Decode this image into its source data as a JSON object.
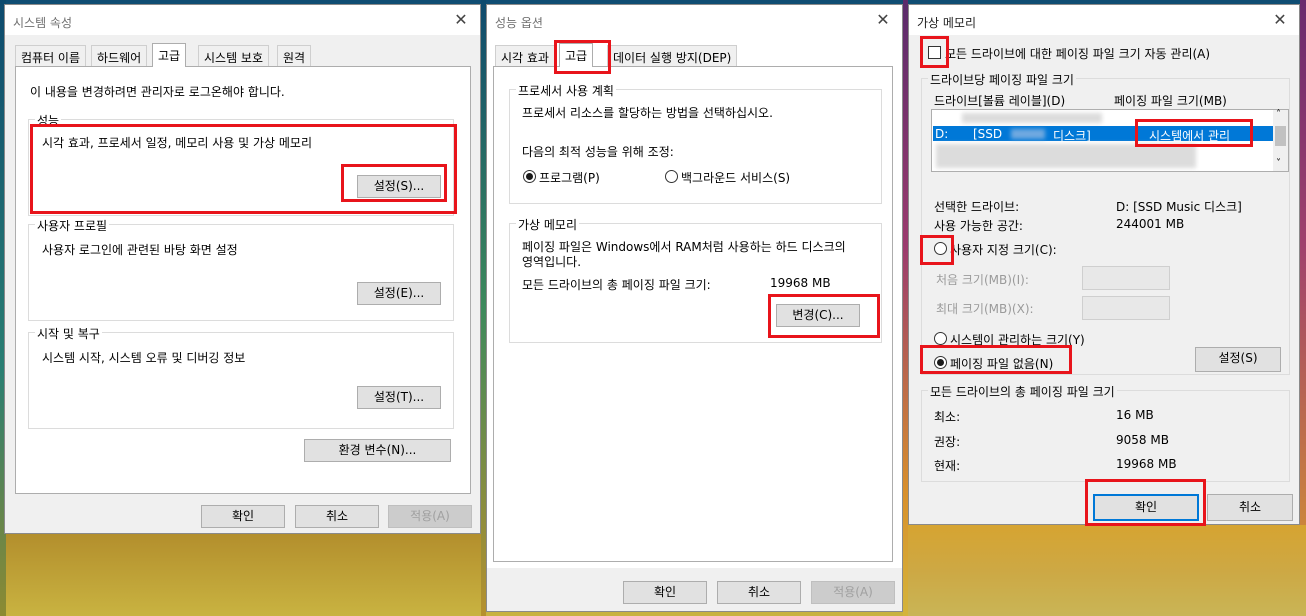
{
  "colors": {
    "highlight": "#e8141b",
    "selection": "#0078d7"
  },
  "w1": {
    "title": "시스템 속성",
    "tabs": [
      "컴퓨터 이름",
      "하드웨어",
      "고급",
      "시스템 보호",
      "원격"
    ],
    "admin_note": "이 내용을 변경하려면 관리자로 로그온해야 합니다.",
    "perf": {
      "label": "성능",
      "desc": "시각 효과, 프로세서 일정, 메모리 사용 및 가상 메모리",
      "button": "설정(S)..."
    },
    "profile": {
      "label": "사용자 프로필",
      "desc": "사용자 로그인에 관련된 바탕 화면 설정",
      "button": "설정(E)..."
    },
    "startup": {
      "label": "시작 및 복구",
      "desc": "시스템 시작, 시스템 오류 및 디버깅 정보",
      "button": "설정(T)..."
    },
    "env_button": "환경 변수(N)...",
    "ok": "확인",
    "cancel": "취소",
    "apply": "적용(A)"
  },
  "w2": {
    "title": "성능 옵션",
    "tabs": [
      "시각 효과",
      "고급",
      "데이터 실행 방지(DEP)"
    ],
    "sched": {
      "label": "프로세서 사용 계획",
      "desc": "프로세서 리소스를 할당하는 방법을 선택하십시오.",
      "adjust": "다음의 최적 성능을 위해 조정:",
      "opt_programs": "프로그램(P)",
      "opt_services": "백그라운드 서비스(S)"
    },
    "vm": {
      "label": "가상 메모리",
      "desc1": "페이징 파일은 Windows에서 RAM처럼 사용하는 하드 디스크의",
      "desc2": "영역입니다.",
      "total_label": "모든 드라이브의 총 페이징 파일 크기:",
      "total_value": "19968 MB",
      "button": "변경(C)..."
    },
    "ok": "확인",
    "cancel": "취소",
    "apply": "적용(A)"
  },
  "w3": {
    "title": "가상 메모리",
    "auto_manage": "모든 드라이브에 대한 페이징 파일 크기 자동 관리(A)",
    "per_drive_label": "드라이브당 페이징 파일 크기",
    "col_drive": "드라이브[볼륨 레이블](D)",
    "col_size": "페이징 파일 크기(MB)",
    "sel_row": {
      "drive": "D:",
      "label_start": "[SSD",
      "label_end": "디스크]",
      "size": "시스템에서 관리"
    },
    "selected_drive_label": "선택한 드라이브:",
    "selected_drive_value": "D:  [SSD Music 디스크]",
    "space_label": "사용 가능한 공간:",
    "space_value": "244001 MB",
    "custom": "사용자 지정 크기(C):",
    "initial": "처음 크기(MB)(I):",
    "max": "최대 크기(MB)(X):",
    "system_managed": "시스템이 관리하는 크기(Y)",
    "no_paging": "페이징 파일 없음(N)",
    "set_button": "설정(S)",
    "total_group": "모든 드라이브의 총 페이징 파일 크기",
    "min_label": "최소:",
    "min_value": "16 MB",
    "rec_label": "권장:",
    "rec_value": "9058 MB",
    "cur_label": "현재:",
    "cur_value": "19968 MB",
    "ok": "확인",
    "cancel": "취소"
  }
}
